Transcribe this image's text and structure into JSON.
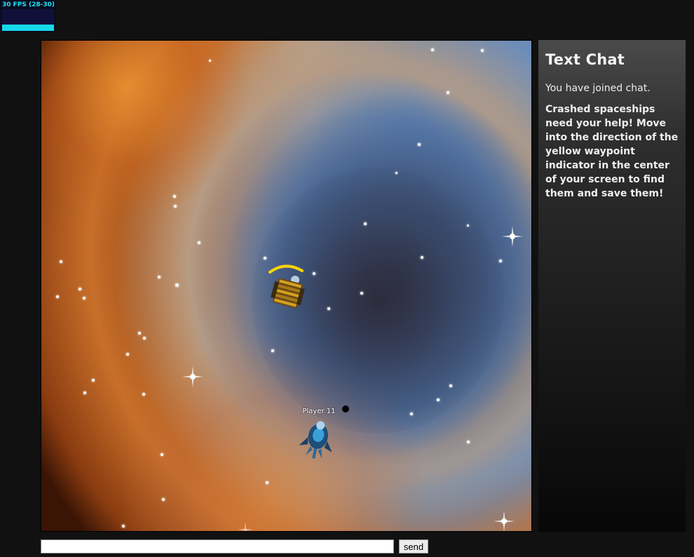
{
  "fps_meter": {
    "label": "30 FPS (28-30)",
    "bar_color": "#15d8e8"
  },
  "game": {
    "player_name": "Player 11",
    "waypoint_color": "#ffd400"
  },
  "chat": {
    "title": "Text Chat",
    "messages": [
      "You have joined chat.",
      "Crashed spaceships need your help! Move into the direction of the yellow waypoint indicator in the center of your screen to find them and save them!"
    ],
    "input_value": "",
    "send_label": "send"
  }
}
